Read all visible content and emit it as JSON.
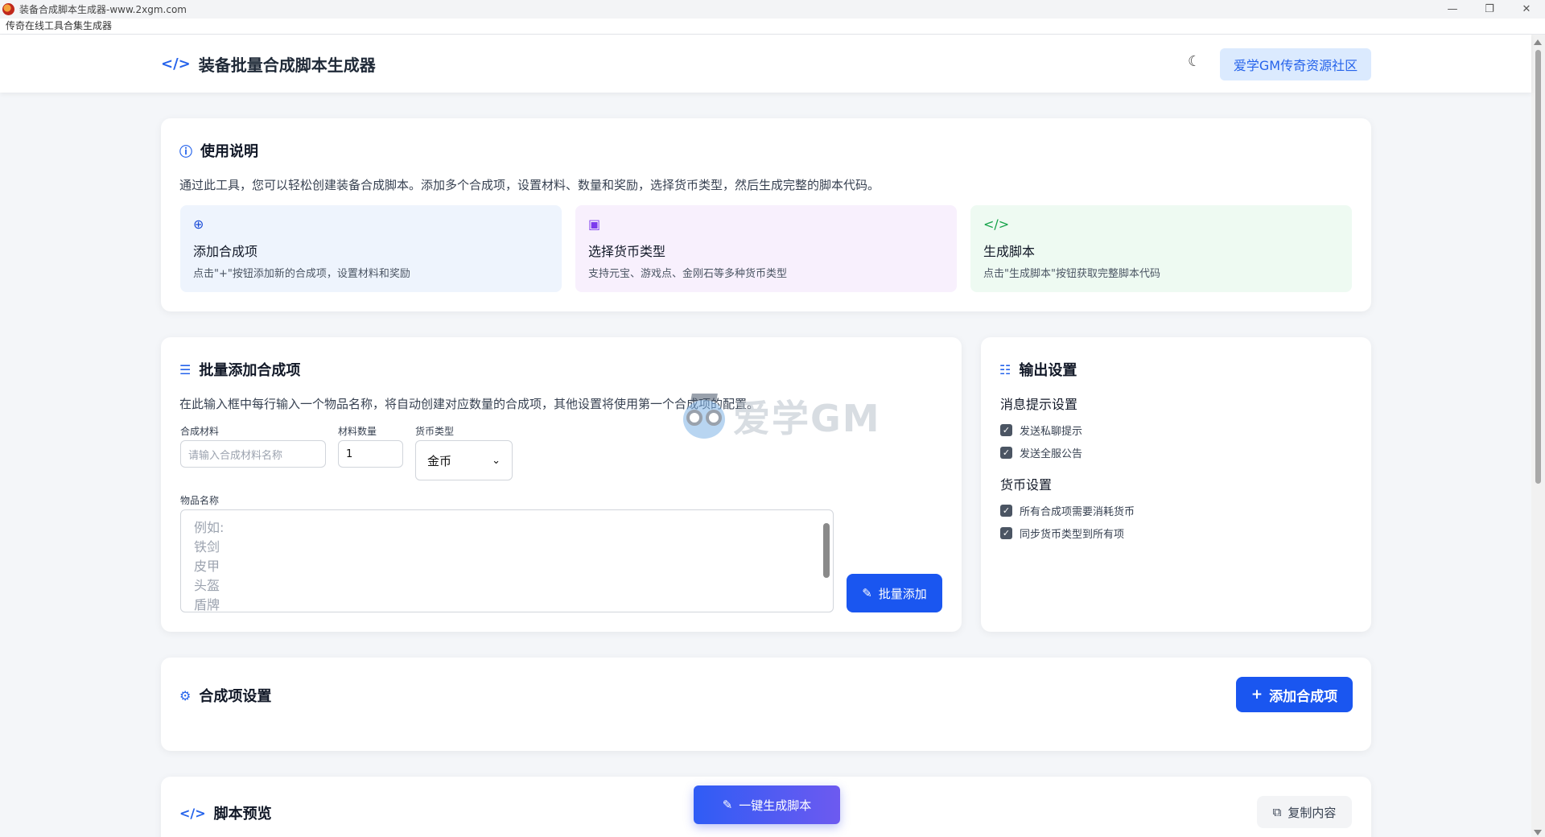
{
  "window": {
    "title": "装备合成脚本生成器-www.2xgm.com",
    "menu_text": "传奇在线工具合集生成器",
    "controls": {
      "minimize": "—",
      "maximize": "❐",
      "close": "✕"
    }
  },
  "header": {
    "title": "装备批量合成脚本生成器",
    "code_icon": "</>",
    "theme_icon": "☾",
    "community_button": "爱学GM传奇资源社区"
  },
  "usage": {
    "title": "使用说明",
    "description": "通过此工具，您可以轻松创建装备合成脚本。添加多个合成项，设置材料、数量和奖励，选择货币类型，然后生成完整的脚本代码。",
    "features": [
      {
        "icon": "⊕",
        "title": "添加合成项",
        "desc": "点击\"+\"按钮添加新的合成项，设置材料和奖励",
        "bg": "#eef4fd",
        "icon_color": "#1d4ed8"
      },
      {
        "icon": "▣",
        "title": "选择货币类型",
        "desc": "支持元宝、游戏点、金刚石等多种货币类型",
        "bg": "#f8f0fd",
        "icon_color": "#7c3aed"
      },
      {
        "icon": "</>",
        "title": "生成脚本",
        "desc": "点击\"生成脚本\"按钮获取完整脚本代码",
        "bg": "#eefaf2",
        "icon_color": "#16a34a"
      }
    ]
  },
  "batch": {
    "title": "批量添加合成项",
    "description": "在此输入框中每行输入一个物品名称，将自动创建对应数量的合成项，其他设置将使用第一个合成项的配置。",
    "material_label": "合成材料",
    "material_placeholder": "请输入合成材料名称",
    "quantity_label": "材料数量",
    "quantity_value": "1",
    "currency_label": "货币类型",
    "currency_value": "金币",
    "item_label": "物品名称",
    "item_placeholder_lines": [
      "例如:",
      "铁剑",
      "皮甲",
      "头盔",
      "盾牌"
    ],
    "add_button": "批量添加"
  },
  "output": {
    "title": "输出设置",
    "message_title": "消息提示设置",
    "message_options": [
      "发送私聊提示",
      "发送全服公告"
    ],
    "currency_title": "货币设置",
    "currency_options": [
      "所有合成项需要消耗货币",
      "同步货币类型到所有项"
    ]
  },
  "items": {
    "title": "合成项设置",
    "add_button": "添加合成项"
  },
  "preview": {
    "title": "脚本预览",
    "copy_button": "复制内容",
    "generate_button": "一键生成脚本"
  },
  "watermark": {
    "text": "爱学GM"
  }
}
